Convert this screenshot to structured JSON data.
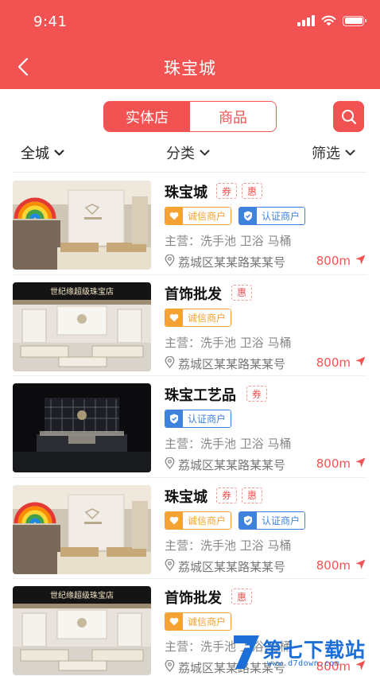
{
  "status_bar": {
    "time": "9:41"
  },
  "header": {
    "title": "珠宝城"
  },
  "segment": {
    "tabs": [
      {
        "label": "实体店",
        "active": true
      },
      {
        "label": "商品",
        "active": false
      }
    ]
  },
  "filters": {
    "city": "全城",
    "category": "分类",
    "filter": "筛选"
  },
  "colors": {
    "primary": "#f25352",
    "credit": "#f3a233",
    "certified": "#3f82de"
  },
  "shops": [
    {
      "name": "珠宝城",
      "tags": [
        "券",
        "惠"
      ],
      "badges": [
        "诚信商户",
        "认证商户"
      ],
      "main_business": "主营：洗手池 卫浴 马桶",
      "address": "荔城区某某路某某号",
      "distance": "800m",
      "image": "jewelry-store-rainbow"
    },
    {
      "name": "首饰批发",
      "tags": [
        "惠"
      ],
      "badges": [
        "诚信商户"
      ],
      "main_business": "主营：洗手池 卫浴 马桶",
      "address": "荔城区某某路某某号",
      "distance": "800m",
      "image": "jewelry-store-white",
      "image_sign": "世纪缘超级珠宝店"
    },
    {
      "name": "珠宝工艺品",
      "tags": [
        "券"
      ],
      "badges": [
        "认证商户"
      ],
      "main_business": "主营：洗手池 卫浴 马桶",
      "address": "荔城区某某路某某号",
      "distance": "800m",
      "image": "jewelry-store-dark"
    },
    {
      "name": "珠宝城",
      "tags": [
        "券",
        "惠"
      ],
      "badges": [
        "诚信商户",
        "认证商户"
      ],
      "main_business": "主营：洗手池 卫浴 马桶",
      "address": "荔城区某某路某某号",
      "distance": "800m",
      "image": "jewelry-store-rainbow"
    },
    {
      "name": "首饰批发",
      "tags": [
        "惠"
      ],
      "badges": [
        "诚信商户"
      ],
      "main_business": "主营：洗手池 卫浴 马桶",
      "address": "荔城区某某路某某号",
      "distance": "800m",
      "image": "jewelry-store-white",
      "image_sign": "世纪缘超级珠宝店"
    }
  ],
  "watermark": {
    "text": "第七下载站",
    "url": "www.d7down.com"
  }
}
